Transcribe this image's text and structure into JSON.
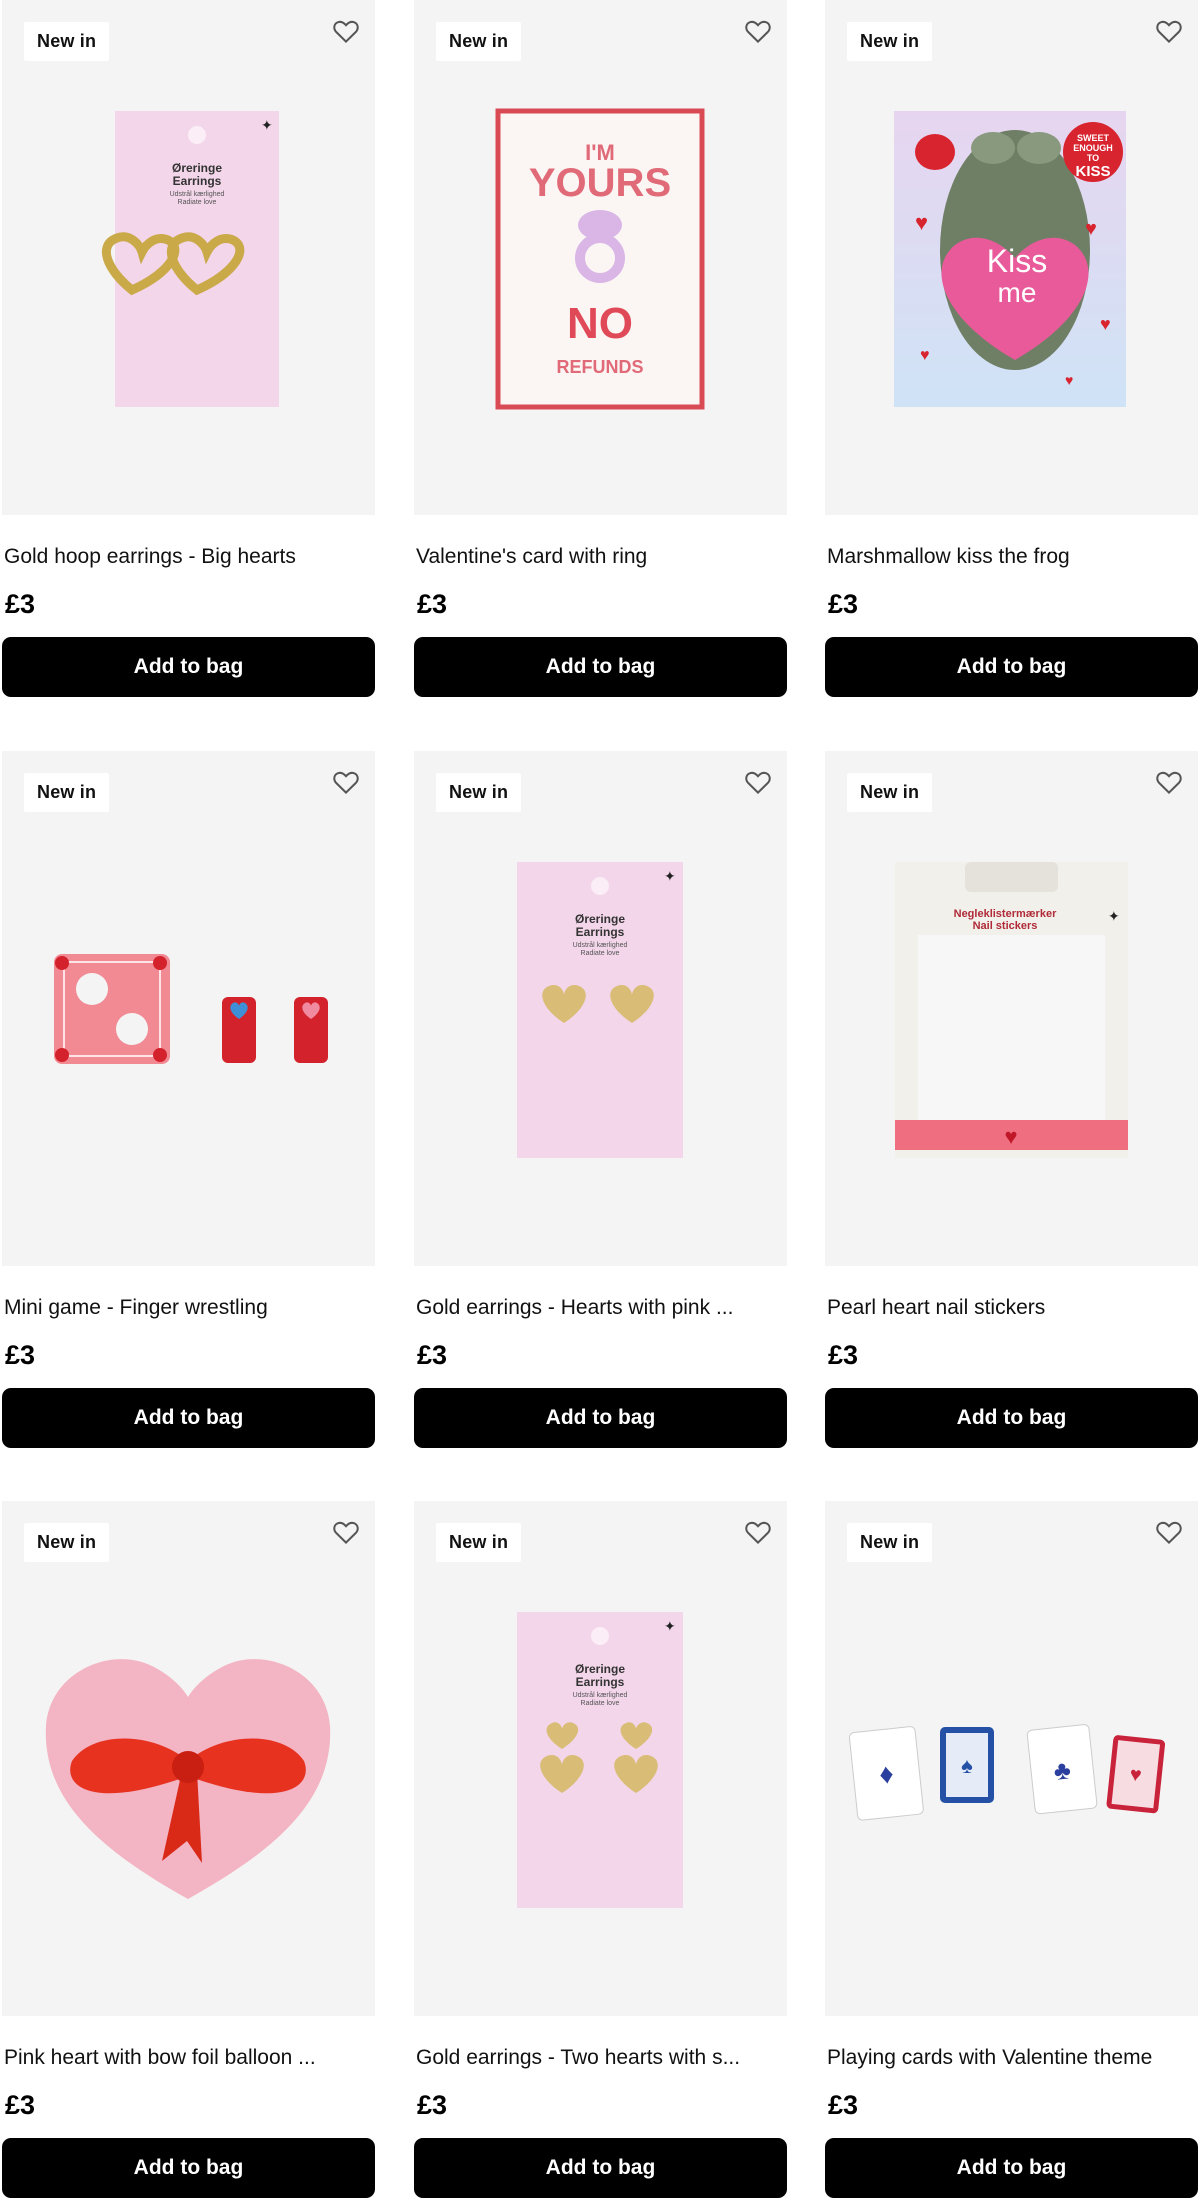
{
  "products": [
    {
      "badge": "New in",
      "title": "Gold hoop earrings - Big hearts",
      "price": "£3",
      "cta": "Add to bag",
      "pack": {
        "line1": "Øreringe",
        "line2": "Earrings",
        "line3": "Udstrål kærlighed",
        "line4": "Radiate love"
      }
    },
    {
      "badge": "New in",
      "title": "Valentine's card with ring",
      "price": "£3",
      "cta": "Add to bag",
      "card": {
        "line1": "I'M",
        "line2": "YOURS",
        "line3": "NO",
        "line4": "REFUNDS"
      }
    },
    {
      "badge": "New in",
      "title": "Marshmallow kiss the frog",
      "price": "£3",
      "cta": "Add to bag",
      "box": {
        "sticker1": "SWEET",
        "sticker2": "ENOUGH",
        "sticker3": "TO",
        "sticker4": "KISS",
        "heart1": "Kiss",
        "heart2": "me"
      }
    },
    {
      "badge": "New in",
      "title": "Mini game - Finger wrestling",
      "price": "£3",
      "cta": "Add to bag"
    },
    {
      "badge": "New in",
      "title": "Gold earrings - Hearts with pink ...",
      "price": "£3",
      "cta": "Add to bag",
      "pack": {
        "line1": "Øreringe",
        "line2": "Earrings",
        "line3": "Udstrål kærlighed",
        "line4": "Radiate love"
      }
    },
    {
      "badge": "New in",
      "title": "Pearl heart nail stickers",
      "price": "£3",
      "cta": "Add to bag",
      "pack": {
        "line1": "Negleklistermærker",
        "line2": "Nail stickers"
      }
    },
    {
      "badge": "New in",
      "title": "Pink heart with bow foil balloon ...",
      "price": "£3",
      "cta": "Add to bag"
    },
    {
      "badge": "New in",
      "title": "Gold earrings - Two hearts with s...",
      "price": "£3",
      "cta": "Add to bag",
      "pack": {
        "line1": "Øreringe",
        "line2": "Earrings",
        "line3": "Udstrål kærlighed",
        "line4": "Radiate love"
      }
    },
    {
      "badge": "New in",
      "title": "Playing cards with Valentine theme",
      "price": "£3",
      "cta": "Add to bag"
    }
  ],
  "colors": {
    "button": "#000000",
    "tile": "#f4f4f4",
    "accent": "#e03a4a"
  },
  "icons": {
    "wishlist": "heart-outline-icon"
  }
}
